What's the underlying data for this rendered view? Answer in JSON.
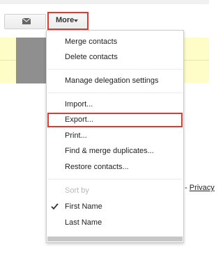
{
  "toolbar": {
    "mail_icon": "envelope-icon",
    "more_label": "More"
  },
  "menu": {
    "merge_contacts": "Merge contacts",
    "delete_contacts": "Delete contacts",
    "manage_delegation": "Manage delegation settings",
    "import": "Import...",
    "export": "Export...",
    "print": "Print...",
    "find_merge": "Find & merge duplicates...",
    "restore": "Restore contacts...",
    "sort_by": "Sort by",
    "first_name": "First Name",
    "last_name": "Last Name"
  },
  "footer": {
    "dash": "- ",
    "privacy_link": "Privacy"
  },
  "colors": {
    "highlight": "#e03a2f",
    "row_yellow": "#fefcc7"
  }
}
